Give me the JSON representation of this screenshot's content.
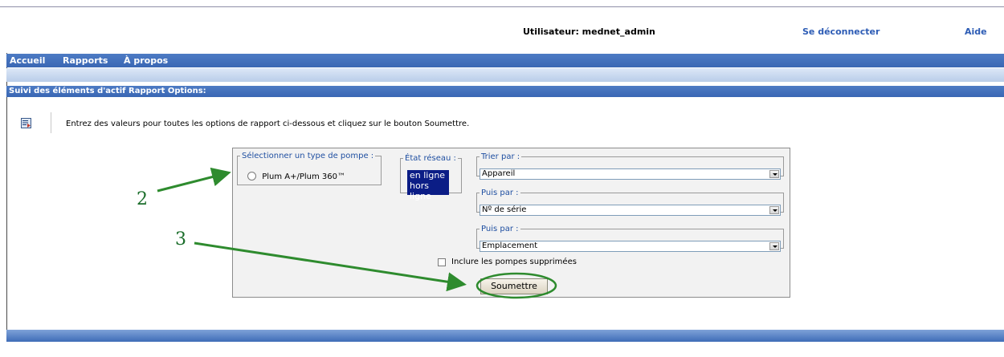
{
  "header": {
    "user_text": "Utilisateur: mednet_admin",
    "logout_label": "Se déconnecter",
    "help_label": "Aide"
  },
  "nav": {
    "items": [
      "Accueil",
      "Rapports",
      "À propos"
    ]
  },
  "section": {
    "title": "Suivi des éléments d'actif Rapport Options:"
  },
  "instructions": "Entrez des valeurs pour toutes les options de rapport ci-dessous et cliquez sur le bouton Soumettre.",
  "form": {
    "pump_type": {
      "legend": "Sélectionner un type de pompe  :",
      "option": "Plum A+/Plum 360™"
    },
    "network_state": {
      "legend": "État réseau  :",
      "options": [
        "en ligne",
        "hors ligne"
      ]
    },
    "sort_by": {
      "legend": "Trier par  :",
      "value": "Appareil"
    },
    "then_by_1": {
      "legend": "Puis par  :",
      "value": "Nº de série"
    },
    "then_by_2": {
      "legend": "Puis par  :",
      "value": "Emplacement"
    },
    "include_deleted_label": "Inclure les pompes supprimées",
    "submit_label": "Soumettre"
  },
  "annotations": {
    "label_2": "2",
    "label_3": "3",
    "color": "#2e8b2e"
  },
  "colors": {
    "nav_bar": "#3f6cb8",
    "link": "#2d5cb5",
    "listbox_bg": "#0b1d86"
  }
}
